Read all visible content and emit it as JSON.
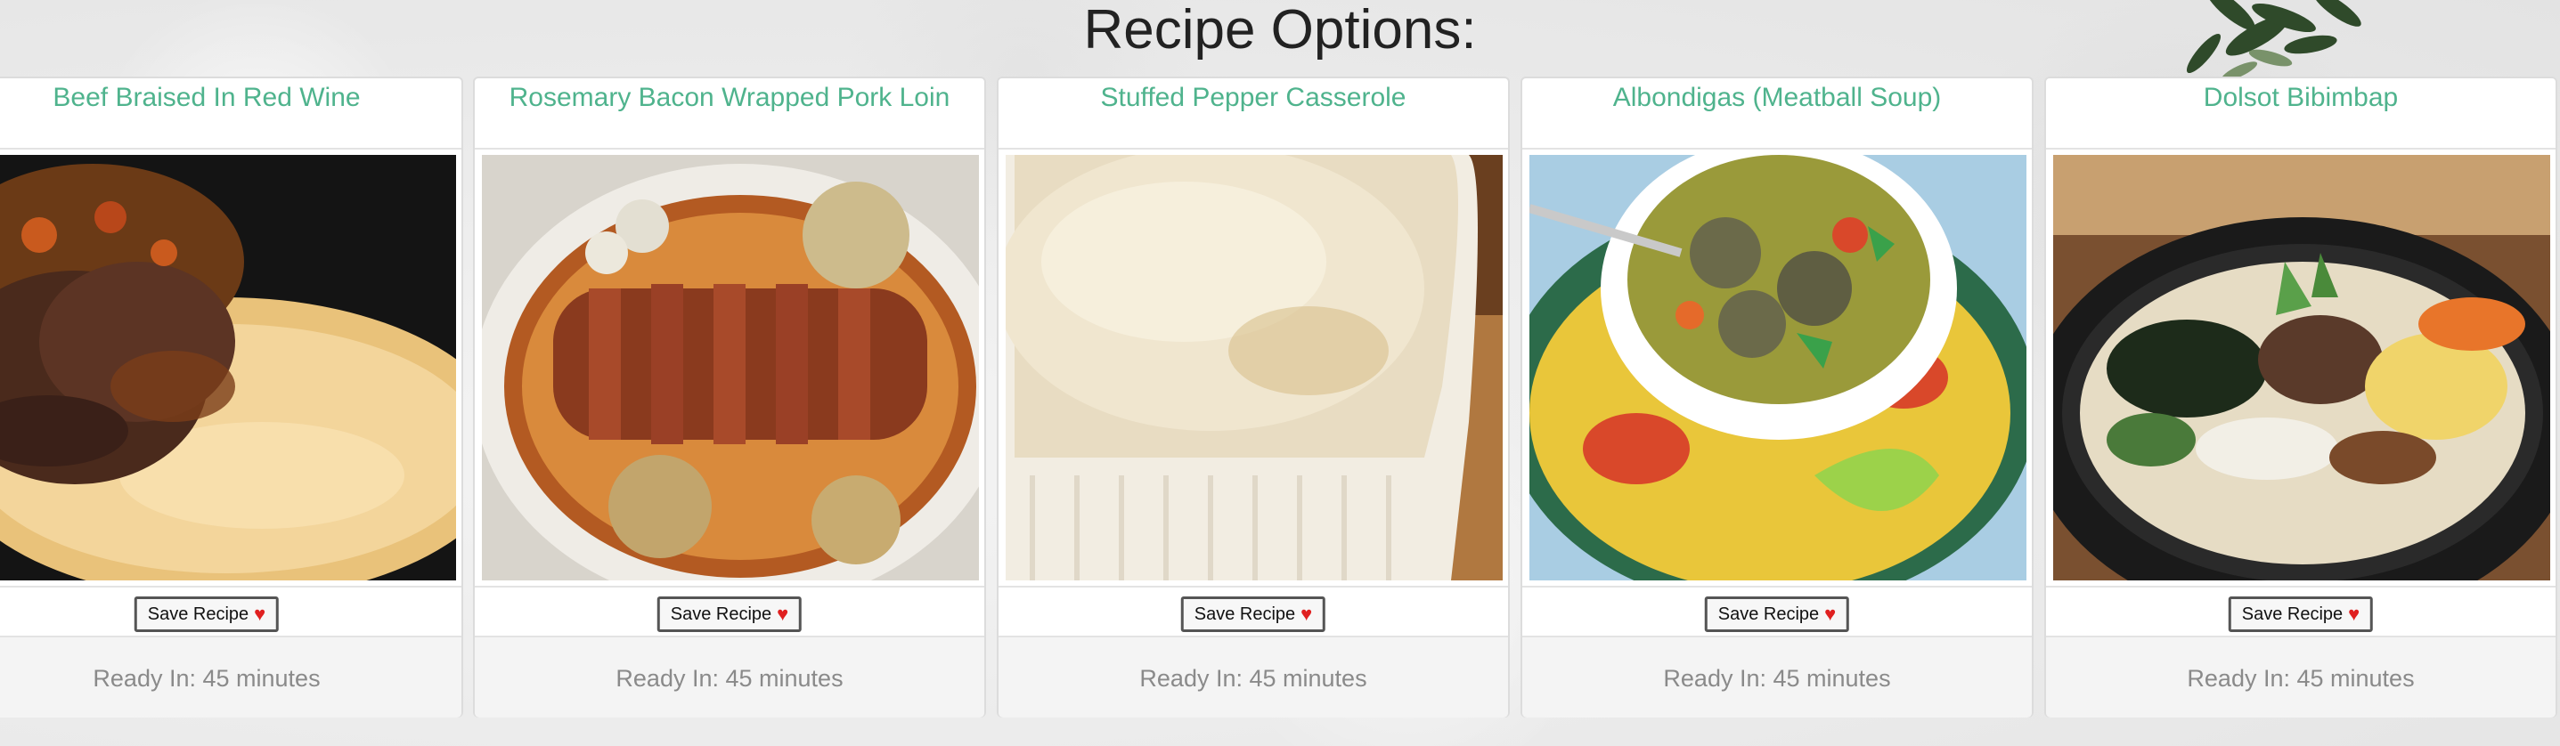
{
  "page": {
    "title": "Recipe Options:"
  },
  "save_label": "Save Recipe",
  "recipes": [
    {
      "title": "Beef Braised In Red Wine",
      "ready": "Ready In: 45 minutes"
    },
    {
      "title": "Rosemary Bacon Wrapped Pork Loin",
      "ready": "Ready In: 45 minutes"
    },
    {
      "title": "Stuffed Pepper Casserole",
      "ready": "Ready In: 45 minutes"
    },
    {
      "title": "Albondigas (Meatball Soup)",
      "ready": "Ready In: 45 minutes"
    },
    {
      "title": "Dolsot Bibimbap",
      "ready": "Ready In: 45 minutes"
    }
  ],
  "icons": {
    "save": "heart-icon"
  },
  "colors": {
    "recipe_title": "#4fb38d",
    "heart": "#e02020"
  }
}
